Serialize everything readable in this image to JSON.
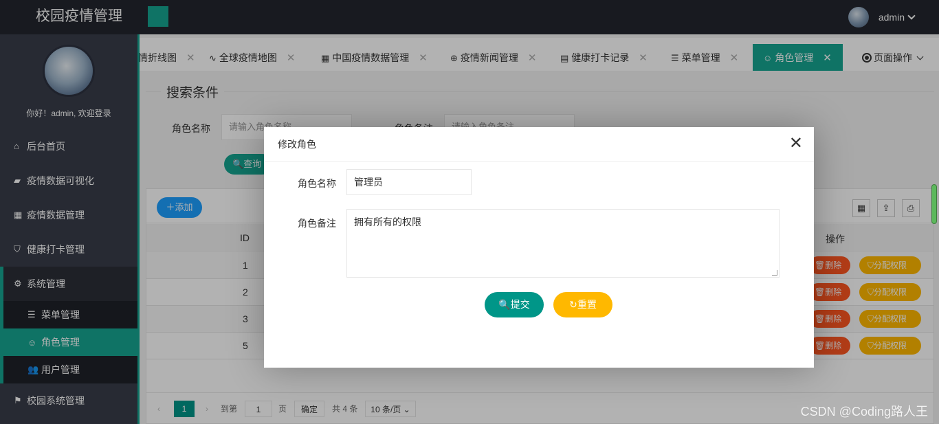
{
  "header": {
    "app_title": "校园疫情管理",
    "user_name": "admin"
  },
  "sidebar": {
    "welcome": "你好！admin, 欢迎登录",
    "items": [
      {
        "label": "后台首页",
        "icon": "home-icon"
      },
      {
        "label": "疫情数据可视化",
        "icon": "chart-icon"
      },
      {
        "label": "疫情数据管理",
        "icon": "table-icon"
      },
      {
        "label": "健康打卡管理",
        "icon": "shield-icon"
      },
      {
        "label": "系统管理",
        "icon": "gear-icon"
      },
      {
        "label": "校园系统管理",
        "icon": "flag-icon"
      }
    ],
    "sub_items": [
      {
        "label": "菜单管理",
        "icon": "menu-icon"
      },
      {
        "label": "角色管理",
        "icon": "smile-icon"
      },
      {
        "label": "用户管理",
        "icon": "users-icon"
      }
    ]
  },
  "tabs": [
    {
      "label": "情折线图"
    },
    {
      "label": "全球疫情地图"
    },
    {
      "label": "中国疫情数据管理"
    },
    {
      "label": "疫情新闻管理"
    },
    {
      "label": "健康打卡记录"
    },
    {
      "label": "菜单管理"
    },
    {
      "label": "角色管理"
    }
  ],
  "page_ops": "页面操作",
  "search": {
    "legend": "搜索条件",
    "role_name_label": "角色名称",
    "role_name_placeholder": "请输入角色名称",
    "role_note_label": "角色备注",
    "role_note_placeholder": "请输入角色备注",
    "query_label": "查询"
  },
  "table": {
    "add_label": "添加",
    "col_id": "ID",
    "col_op": "操作",
    "rows": [
      {
        "id": "1"
      },
      {
        "id": "2"
      },
      {
        "id": "3"
      },
      {
        "id": "5"
      }
    ],
    "delete_label": "删除",
    "assign_label": "分配权限"
  },
  "pager": {
    "current": "1",
    "goto_label": "到第",
    "goto_value": "1",
    "page_unit": "页",
    "confirm": "确定",
    "total": "共 4 条",
    "page_size": "10 条/页"
  },
  "modal": {
    "title": "修改角色",
    "name_label": "角色名称",
    "name_value": "管理员",
    "note_label": "角色备注",
    "note_value": "拥有所有的权限",
    "submit_label": "提交",
    "reset_label": "重置"
  },
  "watermark": "CSDN @Coding路人王"
}
